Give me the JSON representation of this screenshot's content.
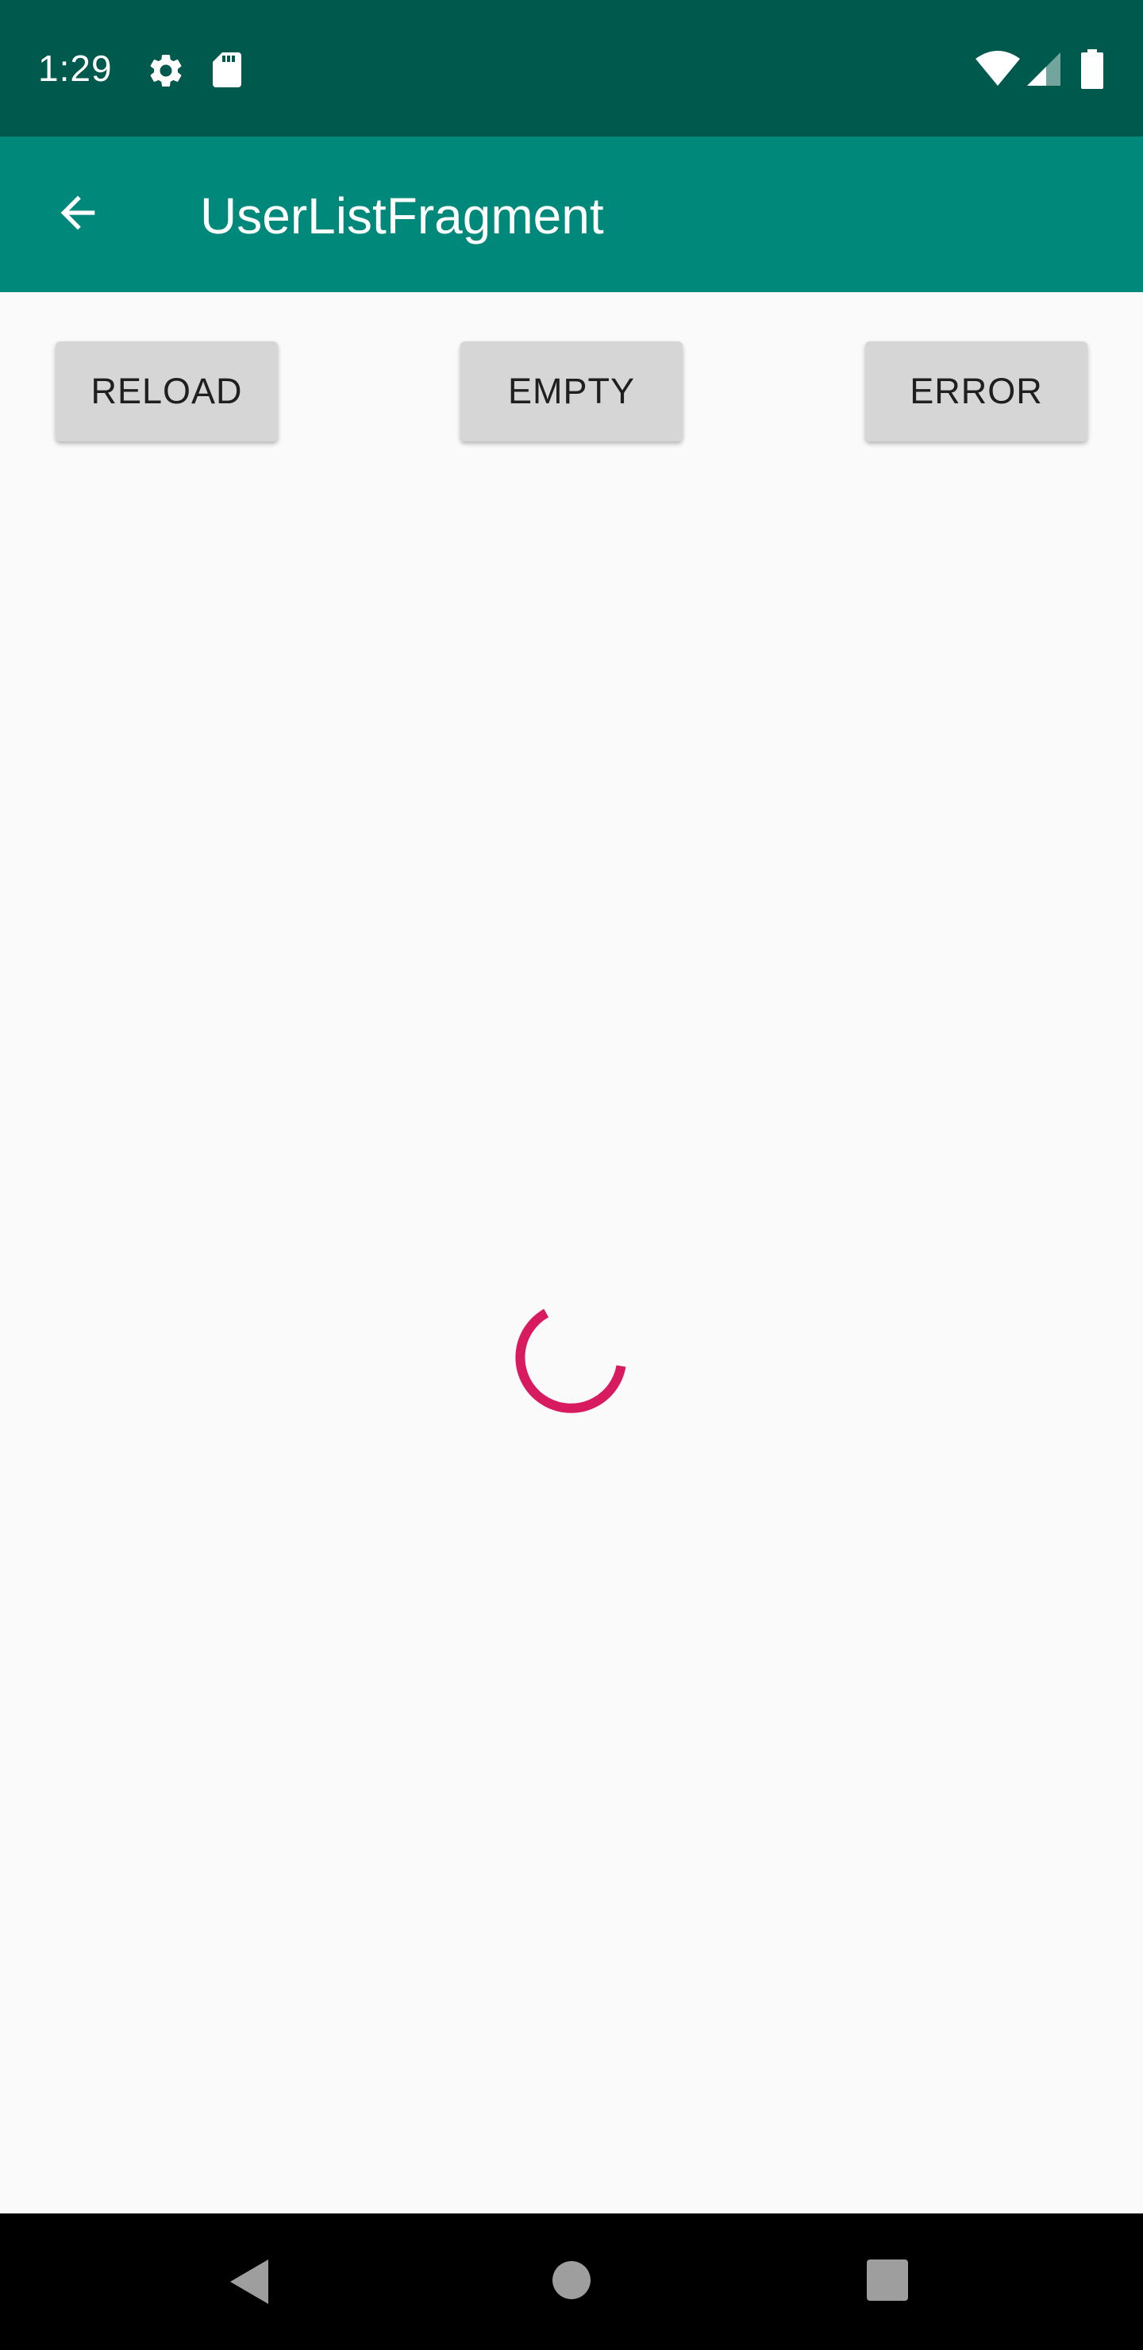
{
  "status_bar": {
    "time": "1:29",
    "background_color": "#00594d",
    "icons": [
      "gear-icon",
      "sd-card-icon",
      "wifi-icon",
      "signal-icon",
      "battery-icon"
    ]
  },
  "app_bar": {
    "title": "UserListFragment",
    "background_color": "#00897b",
    "back_icon": "arrow-left-icon"
  },
  "actions": {
    "reload_label": "RELOAD",
    "empty_label": "EMPTY",
    "error_label": "ERROR"
  },
  "loading": {
    "indicator": "circular-progress",
    "accent_color": "#d81b60"
  },
  "nav_bar": {
    "icons": [
      "nav-back-icon",
      "nav-home-icon",
      "nav-recents-icon"
    ],
    "background_color": "#000000"
  }
}
